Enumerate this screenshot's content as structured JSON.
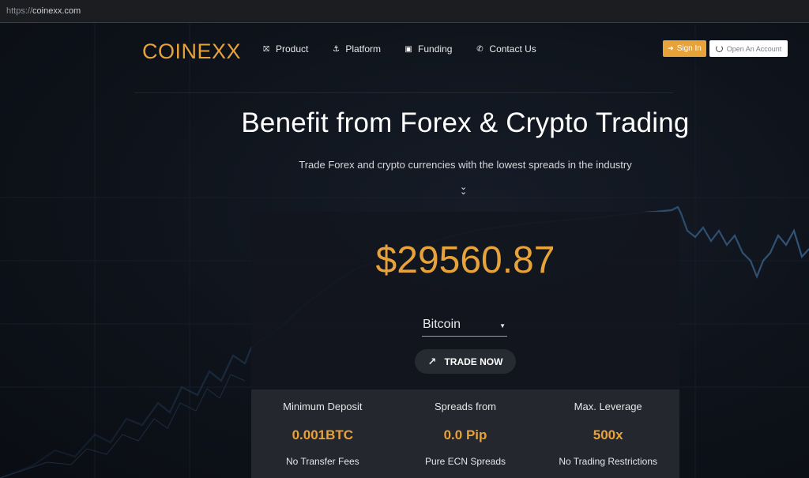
{
  "browser": {
    "url_scheme": "https://",
    "url_host": "coinexx.com"
  },
  "nav": {
    "logo": "COINEXX",
    "items": [
      {
        "label": "Product",
        "icon": "car-icon"
      },
      {
        "label": "Platform",
        "icon": "anchor-icon"
      },
      {
        "label": "Funding",
        "icon": "money-icon"
      },
      {
        "label": "Contact Us",
        "icon": "phone-icon"
      }
    ],
    "sign_in": "Sign In",
    "open_account": "Open An Account"
  },
  "hero": {
    "headline": "Benefit from Forex & Crypto Trading",
    "subline": "Trade Forex and crypto currencies with the lowest spreads in the industry"
  },
  "ticker": {
    "price": "$29560.87",
    "selected_asset": "Bitcoin",
    "trade_button": "TRADE NOW"
  },
  "stats": [
    {
      "label": "Minimum Deposit",
      "value": "0.001BTC",
      "note": "No Transfer Fees"
    },
    {
      "label": "Spreads from",
      "value": "0.0 Pip",
      "note": "Pure ECN Spreads"
    },
    {
      "label": "Max. Leverage",
      "value": "500x",
      "note": "No Trading Restrictions"
    }
  ],
  "colors": {
    "accent": "#e8a23a",
    "background": "#0d1118",
    "panel": "#12161e",
    "stats_bg": "#24272d"
  }
}
